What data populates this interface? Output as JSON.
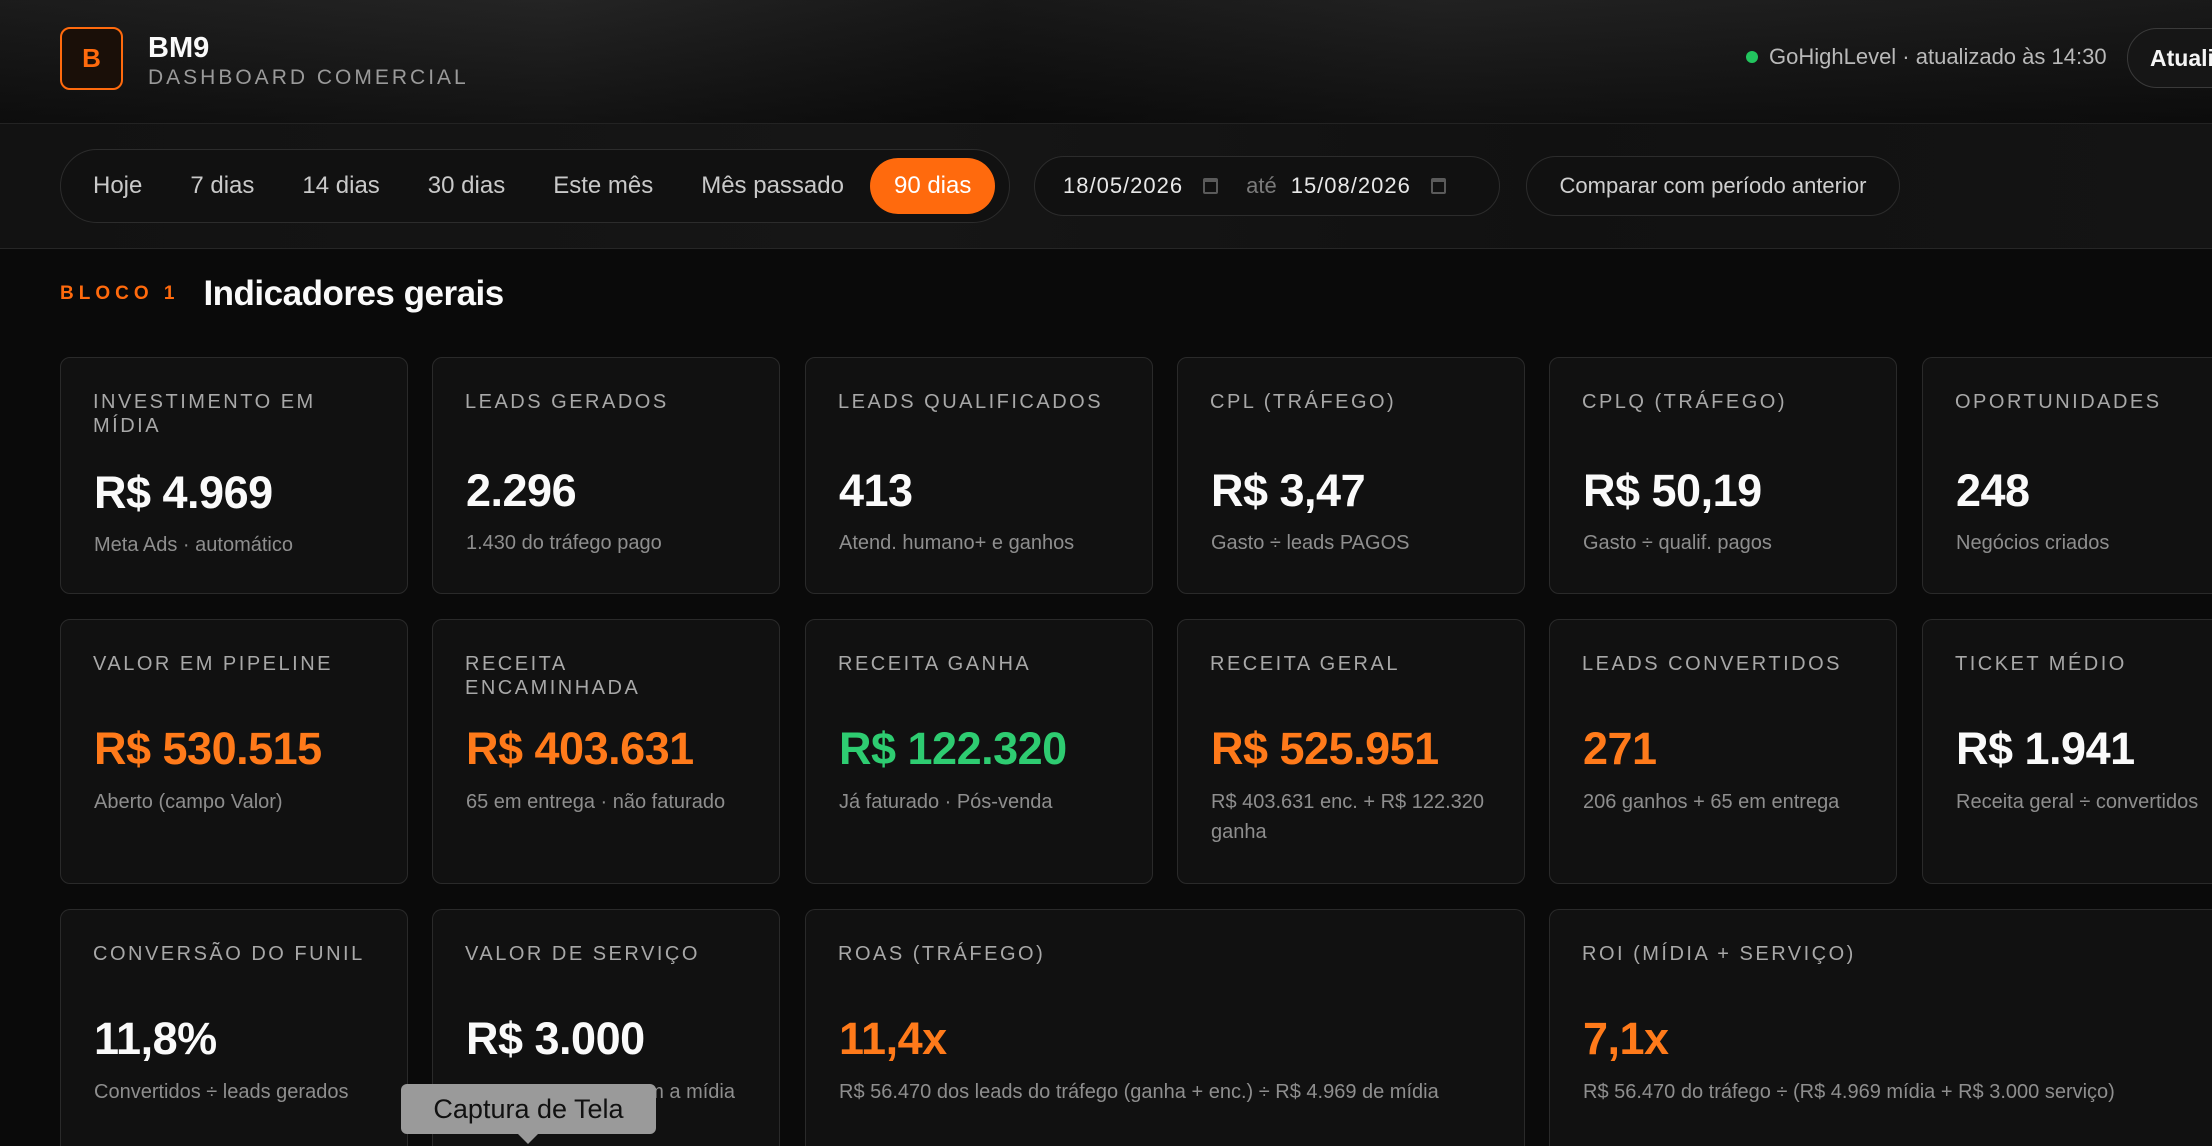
{
  "header": {
    "logo_letter": "B",
    "brand_name": "BM9",
    "brand_subtitle": "DASHBOARD COMERCIAL",
    "status_text": "GoHighLevel · atualizado às 14:30",
    "refresh_label": "Atualizar",
    "status_color": "#22c55e",
    "accent_color": "#ff6a0d"
  },
  "filters": {
    "ranges": [
      "Hoje",
      "7 dias",
      "14 dias",
      "30 dias",
      "Este mês",
      "Mês passado",
      "90 dias"
    ],
    "active_range": "90 dias",
    "date_from": "18/05/2026",
    "date_separator": "até",
    "date_to": "15/08/2026",
    "compare_label": "Comparar com período anterior"
  },
  "section": {
    "tag": "BLOCO 1",
    "title": "Indicadores gerais"
  },
  "cards": [
    {
      "label": "INVESTIMENTO EM MÍDIA",
      "value": "R$ 4.969",
      "sub": "Meta Ads · automático",
      "color": "white"
    },
    {
      "label": "LEADS GERADOS",
      "value": "2.296",
      "sub": "1.430 do tráfego pago",
      "color": "white"
    },
    {
      "label": "LEADS QUALIFICADOS",
      "value": "413",
      "sub": "Atend. humano+ e ganhos",
      "color": "white"
    },
    {
      "label": "CPL (TRÁFEGO)",
      "value": "R$ 3,47",
      "sub": "Gasto ÷ leads PAGOS",
      "color": "white"
    },
    {
      "label": "CPLQ (TRÁFEGO)",
      "value": "R$ 50,19",
      "sub": "Gasto ÷ qualif. pagos",
      "color": "white"
    },
    {
      "label": "OPORTUNIDADES",
      "value": "248",
      "sub": "Negócios criados",
      "color": "white"
    },
    {
      "label": "VALOR EM PIPELINE",
      "value": "R$ 530.515",
      "sub": "Aberto (campo Valor)",
      "color": "orange"
    },
    {
      "label": "RECEITA ENCAMINHADA",
      "value": "R$ 403.631",
      "sub": "65 em entrega · não faturado",
      "color": "orange"
    },
    {
      "label": "RECEITA GANHA",
      "value": "R$ 122.320",
      "sub": "Já faturado · Pós-venda",
      "color": "green"
    },
    {
      "label": "RECEITA GERAL",
      "value": "R$ 525.951",
      "sub": "R$ 403.631 enc. + R$ 122.320 ganha",
      "color": "orange"
    },
    {
      "label": "LEADS CONVERTIDOS",
      "value": "271",
      "sub": "206 ganhos + 65 em entrega",
      "color": "orange"
    },
    {
      "label": "TICKET MÉDIO",
      "value": "R$ 1.941",
      "sub": "Receita geral ÷ convertidos",
      "color": "white"
    },
    {
      "label": "CONVERSÃO DO FUNIL",
      "value": "11,8%",
      "sub": "Convertidos ÷ leads gerados",
      "color": "white"
    },
    {
      "label": "VALOR DE SERVIÇO",
      "value": "R$ 3.000",
      "sub": "m a mídia",
      "color": "white"
    },
    {
      "label": "ROAS (TRÁFEGO)",
      "value": "11,4x",
      "sub": "R$ 56.470 dos leads do tráfego (ganha + enc.) ÷ R$ 4.969 de mídia",
      "color": "orange"
    },
    {
      "label": "ROI (MÍDIA + SERVIÇO)",
      "value": "7,1x",
      "sub": "R$ 56.470 do tráfego ÷ (R$ 4.969 mídia + R$ 3.000 serviço)",
      "color": "orange"
    }
  ],
  "tooltip": {
    "text": "Captura de Tela"
  }
}
